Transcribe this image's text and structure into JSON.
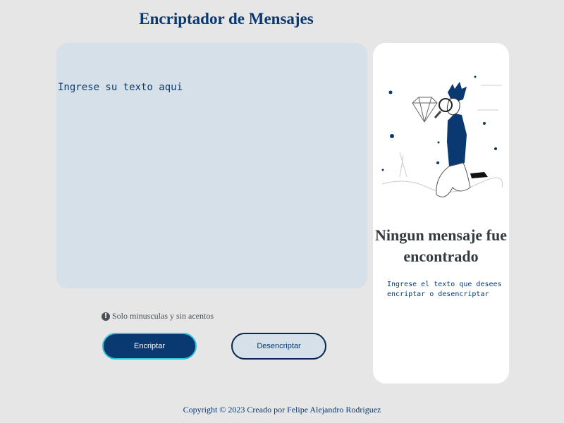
{
  "header": {
    "title": "Encriptador de Mensajes"
  },
  "editor": {
    "placeholder": "Ingrese su texto aqui",
    "value": ""
  },
  "hint": {
    "icon": "exclamation-circle-icon",
    "text": "Solo minusculas y sin acentos"
  },
  "buttons": {
    "encrypt": "Encriptar",
    "decrypt": "Desencriptar"
  },
  "output": {
    "title": "Ningun mensaje fue encontrado",
    "description": "Ingrese el texto que desees encriptar o desencriptar"
  },
  "footer": {
    "text": "Copyright © 2023 Creado por Felipe Alejandro Rodriguez"
  },
  "colors": {
    "primary": "#0a3871",
    "background": "#e6e6e6",
    "input_bg": "#d6e0e8"
  }
}
